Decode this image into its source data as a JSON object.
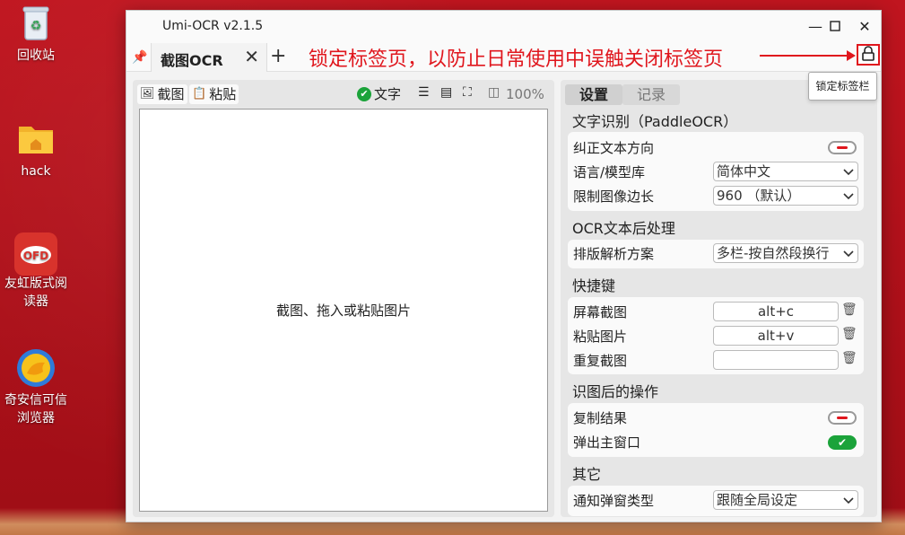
{
  "desktop": {
    "icons": [
      {
        "label": "回收站"
      },
      {
        "label": "hack"
      },
      {
        "label": "友虹版式阅读器"
      },
      {
        "label": "奇安信可信浏览器"
      }
    ]
  },
  "window": {
    "title": "Umi-OCR v2.1.5",
    "tab_label": "截图OCR",
    "annotation": "锁定标签页，以防止日常使用中误触关闭标签页",
    "tooltip": "锁定标签栏"
  },
  "left_toolbar": {
    "screenshot": "截图",
    "paste": "粘贴",
    "text_toggle": "文字",
    "zoom": "100%"
  },
  "canvas": {
    "hint": "截图、拖入或粘贴图片"
  },
  "right_tabs": {
    "settings": "设置",
    "records": "记录"
  },
  "sections": {
    "ocr": "文字识别（PaddleOCR）",
    "post": "OCR文本后处理",
    "hotkeys": "快捷键",
    "after": "识图后的操作",
    "other": "其它"
  },
  "ocr_settings": {
    "correct_direction": "纠正文本方向",
    "language_label": "语言/模型库",
    "language_value": "简体中文",
    "limit_label": "限制图像边长",
    "limit_value": "960 （默认）"
  },
  "post_settings": {
    "layout_label": "排版解析方案",
    "layout_value": "多栏-按自然段换行"
  },
  "hotkey_settings": {
    "screen_label": "屏幕截图",
    "screen_value": "alt+c",
    "paste_label": "粘贴图片",
    "paste_value": "alt+v",
    "repeat_label": "重复截图",
    "repeat_value": ""
  },
  "after_settings": {
    "copy_label": "复制结果",
    "popup_label": "弹出主窗口"
  },
  "other_settings": {
    "notify_label": "通知弹窗类型",
    "notify_value": "跟随全局设定"
  },
  "colors": {
    "accent_red": "#e0161d",
    "toggle_green": "#1ba33a"
  }
}
